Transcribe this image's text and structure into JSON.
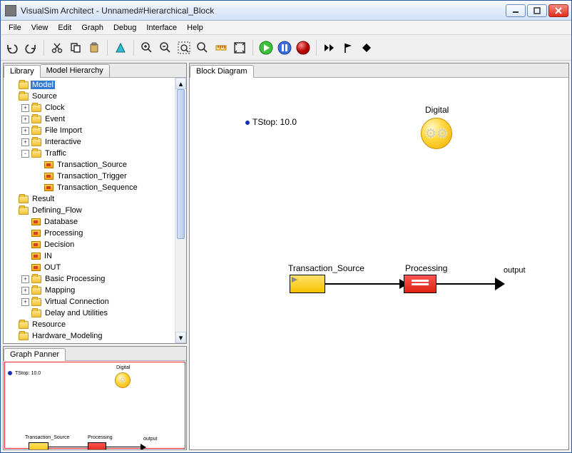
{
  "window": {
    "title": "VisualSim Architect - Unnamed#Hierarchical_Block"
  },
  "menu": {
    "items": [
      "File",
      "View",
      "Edit",
      "Graph",
      "Debug",
      "Interface",
      "Help"
    ]
  },
  "toolbar_icons": [
    "undo",
    "redo",
    "cut",
    "copy",
    "paste",
    "triangle",
    "zoom-in",
    "zoom-out",
    "zoom-region",
    "zoom-reset",
    "ruler",
    "fit",
    "play",
    "pause",
    "stop",
    "step-fwd",
    "flag",
    "diamond"
  ],
  "left_tabs": {
    "lib": "Library",
    "hierarchy": "Model Hierarchy"
  },
  "tree": {
    "n0": {
      "label": "Model",
      "indent": 0,
      "exp": "",
      "icon": "folder",
      "selected": true
    },
    "n1": {
      "label": "Source",
      "indent": 0,
      "exp": "",
      "icon": "folder"
    },
    "n2": {
      "label": "Clock",
      "indent": 1,
      "exp": "+",
      "icon": "folder"
    },
    "n3": {
      "label": "Event",
      "indent": 1,
      "exp": "+",
      "icon": "folder"
    },
    "n4": {
      "label": "File Import",
      "indent": 1,
      "exp": "+",
      "icon": "folder"
    },
    "n5": {
      "label": "Interactive",
      "indent": 1,
      "exp": "+",
      "icon": "folder"
    },
    "n6": {
      "label": "Traffic",
      "indent": 1,
      "exp": "-",
      "icon": "folder"
    },
    "n7": {
      "label": "Transaction_Source",
      "indent": 2,
      "exp": "",
      "icon": "block"
    },
    "n8": {
      "label": "Transaction_Trigger",
      "indent": 2,
      "exp": "",
      "icon": "block"
    },
    "n9": {
      "label": "Transaction_Sequence",
      "indent": 2,
      "exp": "",
      "icon": "block"
    },
    "n10": {
      "label": "Result",
      "indent": 0,
      "exp": "",
      "icon": "folder"
    },
    "n11": {
      "label": "Defining_Flow",
      "indent": 0,
      "exp": "",
      "icon": "folder"
    },
    "n12": {
      "label": "Database",
      "indent": 1,
      "exp": "",
      "icon": "block"
    },
    "n13": {
      "label": "Processing",
      "indent": 1,
      "exp": "",
      "icon": "block"
    },
    "n14": {
      "label": "Decision",
      "indent": 1,
      "exp": "",
      "icon": "block"
    },
    "n15": {
      "label": "IN",
      "indent": 1,
      "exp": "",
      "icon": "block"
    },
    "n16": {
      "label": "OUT",
      "indent": 1,
      "exp": "",
      "icon": "block"
    },
    "n17": {
      "label": "Basic Processing",
      "indent": 1,
      "exp": "+",
      "icon": "folder"
    },
    "n18": {
      "label": "Mapping",
      "indent": 1,
      "exp": "+",
      "icon": "folder"
    },
    "n19": {
      "label": "Virtual Connection",
      "indent": 1,
      "exp": "+",
      "icon": "folder"
    },
    "n20": {
      "label": "Delay and Utilities",
      "indent": 1,
      "exp": "",
      "icon": "folder"
    },
    "n21": {
      "label": "Resource",
      "indent": 0,
      "exp": "",
      "icon": "folder"
    },
    "n22": {
      "label": "Hardware_Modeling",
      "indent": 0,
      "exp": "",
      "icon": "folder"
    }
  },
  "panner": {
    "tab": "Graph Panner"
  },
  "diagram": {
    "tab": "Block Diagram",
    "tstop": "TStop: 10.0",
    "digital": "Digital",
    "src": "Transaction_Source",
    "proc": "Processing",
    "out": "output"
  }
}
